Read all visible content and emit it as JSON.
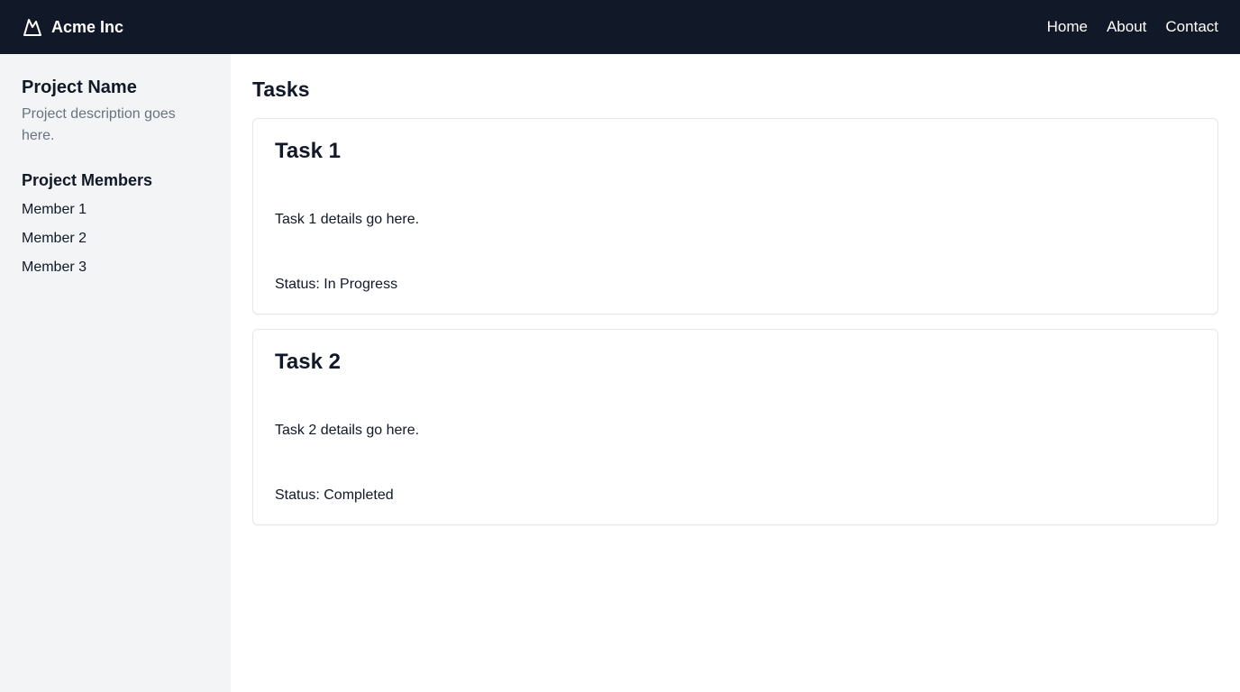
{
  "header": {
    "brand": "Acme Inc",
    "logo_icon": "mountain-icon",
    "nav": [
      {
        "label": "Home"
      },
      {
        "label": "About"
      },
      {
        "label": "Contact"
      }
    ],
    "colors": {
      "background": "#111827",
      "text": "#ffffff"
    }
  },
  "sidebar": {
    "project_name": "Project Name",
    "project_description": "Project description goes here.",
    "members_title": "Project Members",
    "members": [
      "Member 1",
      "Member 2",
      "Member 3"
    ],
    "colors": {
      "background": "#f2f4f6"
    }
  },
  "main": {
    "title": "Tasks",
    "tasks": [
      {
        "title": "Task 1",
        "details": "Task 1 details go here.",
        "status": "Status: In Progress"
      },
      {
        "title": "Task 2",
        "details": "Task 2 details go here.",
        "status": "Status: Completed"
      }
    ]
  }
}
